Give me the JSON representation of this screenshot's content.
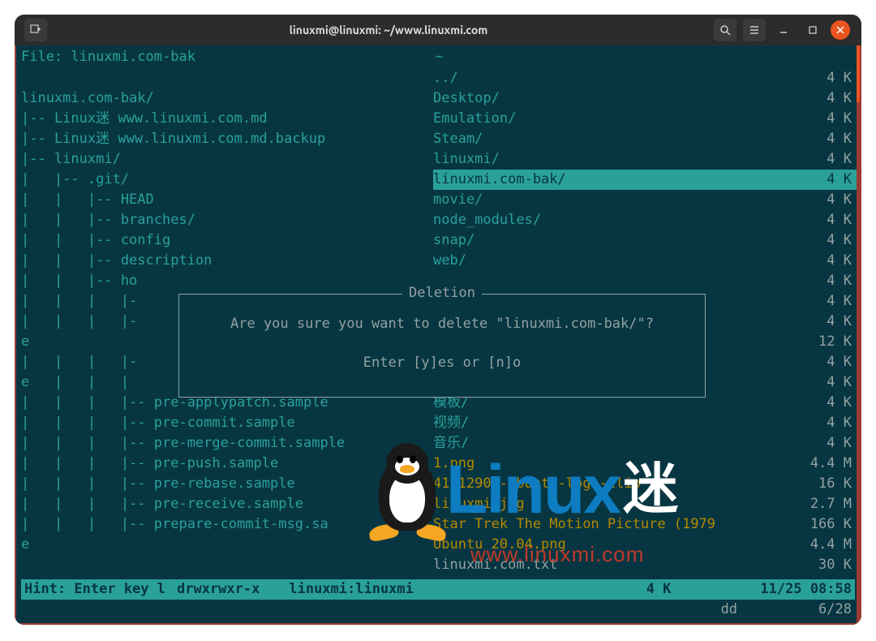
{
  "window": {
    "title": "linuxmi@linuxmi: ~/www.linuxmi.com"
  },
  "header": {
    "left_label": "File:",
    "left_value": "linuxmi.com-bak",
    "right_value": "~"
  },
  "tree": [
    "",
    "linuxmi.com-bak/",
    "|-- Linux迷 www.linuxmi.com.md",
    "|-- Linux迷 www.linuxmi.com.md.backup",
    "|-- linuxmi/",
    "|   |-- .git/",
    "|   |   |-- HEAD",
    "|   |   |-- branches/",
    "|   |   |-- config",
    "|   |   |-- description",
    "|   |   |-- ho",
    "|   |   |   |-",
    "|   |   |   |-",
    "e",
    "|   |   |   |-",
    "e   |   |   |",
    "|   |   |   |-- pre-applypatch.sample",
    "|   |   |   |-- pre-commit.sample",
    "|   |   |   |-- pre-merge-commit.sample",
    "|   |   |   |-- pre-push.sample",
    "|   |   |   |-- pre-rebase.sample",
    "|   |   |   |-- pre-receive.sample",
    "|   |   |   |-- prepare-commit-msg.sa",
    "e"
  ],
  "files": [
    {
      "name": "../",
      "size": "4 K",
      "type": "dir",
      "sel": false
    },
    {
      "name": "Desktop/",
      "size": "4 K",
      "type": "dir",
      "sel": false
    },
    {
      "name": "Emulation/",
      "size": "4 K",
      "type": "dir",
      "sel": false
    },
    {
      "name": "Steam/",
      "size": "4 K",
      "type": "dir",
      "sel": false
    },
    {
      "name": "linuxmi/",
      "size": "4 K",
      "type": "dir",
      "sel": false
    },
    {
      "name": "linuxmi.com-bak/",
      "size": "4 K",
      "type": "dir",
      "sel": true
    },
    {
      "name": "movie/",
      "size": "4 K",
      "type": "dir",
      "sel": false
    },
    {
      "name": "node_modules/",
      "size": "4 K",
      "type": "dir",
      "sel": false
    },
    {
      "name": "snap/",
      "size": "4 K",
      "type": "dir",
      "sel": false
    },
    {
      "name": "web/",
      "size": "4 K",
      "type": "dir",
      "sel": false
    },
    {
      "name": "",
      "size": "4 K",
      "type": "dir",
      "sel": false
    },
    {
      "name": "",
      "size": "4 K",
      "type": "dir",
      "sel": false
    },
    {
      "name": "",
      "size": "4 K",
      "type": "dir",
      "sel": false
    },
    {
      "name": "",
      "size": "12 K",
      "type": "dir",
      "sel": false
    },
    {
      "name": "",
      "size": "4 K",
      "type": "dir",
      "sel": false
    },
    {
      "name": "",
      "size": "4 K",
      "type": "dir",
      "sel": false
    },
    {
      "name": "模板/",
      "size": "4 K",
      "type": "dir",
      "sel": false
    },
    {
      "name": "视频/",
      "size": "4 K",
      "type": "dir",
      "sel": false
    },
    {
      "name": "音乐/",
      "size": "4 K",
      "type": "dir",
      "sel": false
    },
    {
      "name": "1.png",
      "size": "4.4 M",
      "type": "img",
      "sel": false
    },
    {
      "name": "41-12903-ubuntu-logo-clip",
      "size": "16 K",
      "type": "img",
      "sel": false
    },
    {
      "name": "linuxmi.jpg",
      "size": "2.7 M",
      "type": "img",
      "sel": false
    },
    {
      "name": "Star Trek The Motion Picture (1979",
      "size": "166 K",
      "type": "img",
      "sel": false
    },
    {
      "name": "Ubuntu 20.04.png",
      "size": "4.4 M",
      "type": "img",
      "sel": false
    },
    {
      "name": "linuxmi.com.txt",
      "size": "30 K",
      "type": "file",
      "sel": false
    }
  ],
  "dialog": {
    "title": "Deletion",
    "message": "Are you sure you want to delete \"linuxmi.com-bak/\"?",
    "prompt": "Enter [y]es or [n]o"
  },
  "status1": {
    "hint": "Hint: Enter key l",
    "perms": "drwxrwxr-x",
    "owner": "linuxmi:linuxmi",
    "size": "4 K",
    "date": "11/25 08:58"
  },
  "status2": {
    "mode": "dd",
    "pos": "6/28"
  },
  "watermark": {
    "brand1": "Linux",
    "brand2": "迷",
    "url": "www.linuxmi.com"
  }
}
